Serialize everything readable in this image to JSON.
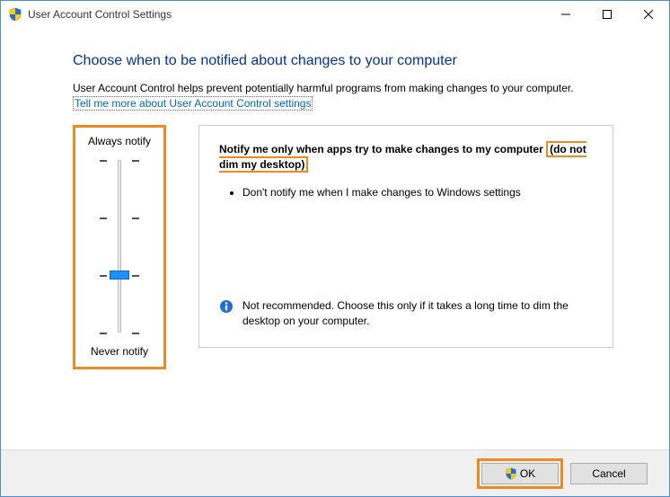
{
  "title": "User Account Control Settings",
  "heading": "Choose when to be notified about changes to your computer",
  "intro": "User Account Control helps prevent potentially harmful programs from making changes to your computer.",
  "link_text": "Tell me more about User Account Control settings",
  "slider": {
    "top_label": "Always notify",
    "bottom_label": "Never notify"
  },
  "description": {
    "title_prefix": "Notify me only when apps try to make changes to my computer ",
    "title_highlight": "(do not dim my desktop)",
    "bullet1": "Don't notify me when I make changes to Windows settings",
    "warning": "Not recommended. Choose this only if it takes a long time to dim the desktop on your computer."
  },
  "buttons": {
    "ok": "OK",
    "cancel": "Cancel"
  }
}
